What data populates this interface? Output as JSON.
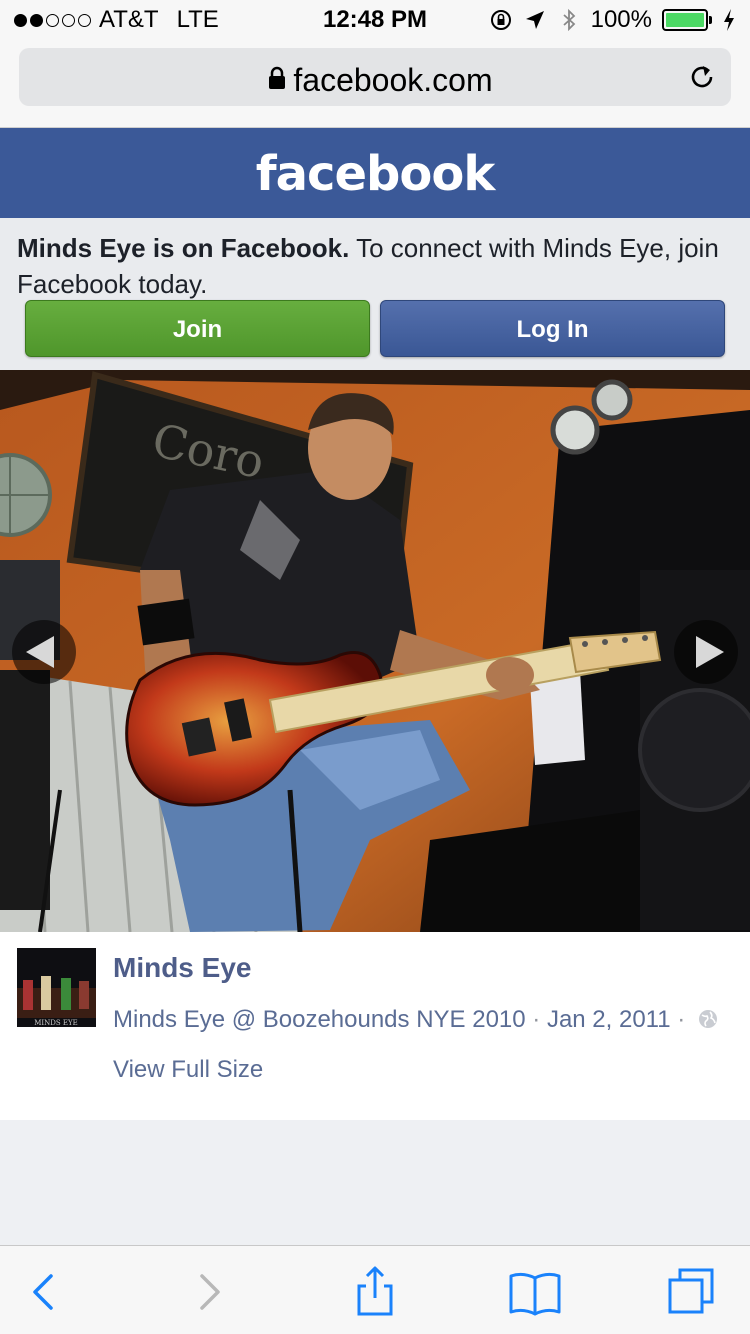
{
  "status_bar": {
    "carrier": "AT&T",
    "network": "LTE",
    "time": "12:48 PM",
    "battery_percent": "100%",
    "signal_bars_filled": 2,
    "signal_bars_total": 5,
    "icons": [
      "orientation-lock-icon",
      "location-arrow-icon",
      "bluetooth-icon",
      "battery-icon",
      "charging-bolt-icon"
    ]
  },
  "browser": {
    "url": "facebook.com",
    "reload_icon": "reload-icon",
    "lock_icon": "lock-icon"
  },
  "header": {
    "logo": "facebook",
    "color": "#3b5998"
  },
  "promo": {
    "bold_text": "Minds Eye is on Facebook.",
    "text": " To connect with Minds Eye, join Facebook today.",
    "join_label": "Join",
    "login_label": "Log In",
    "join_color": "#5aa133",
    "login_color": "#4462a3"
  },
  "photo": {
    "prev_icon": "prev-arrow-icon",
    "next_icon": "next-arrow-icon"
  },
  "post": {
    "page_name": "Minds Eye",
    "caption": "Minds Eye @ Boozehounds NYE 2010",
    "separator": " · ",
    "date": "Jan 2, 2011",
    "view_full_size": "View Full Size",
    "thumb_text": "MINDS EYE"
  },
  "toolbar": {
    "icons": [
      "back-icon",
      "forward-icon",
      "share-icon",
      "bookmarks-icon",
      "tabs-icon"
    ],
    "tint": "#1a82fb"
  }
}
